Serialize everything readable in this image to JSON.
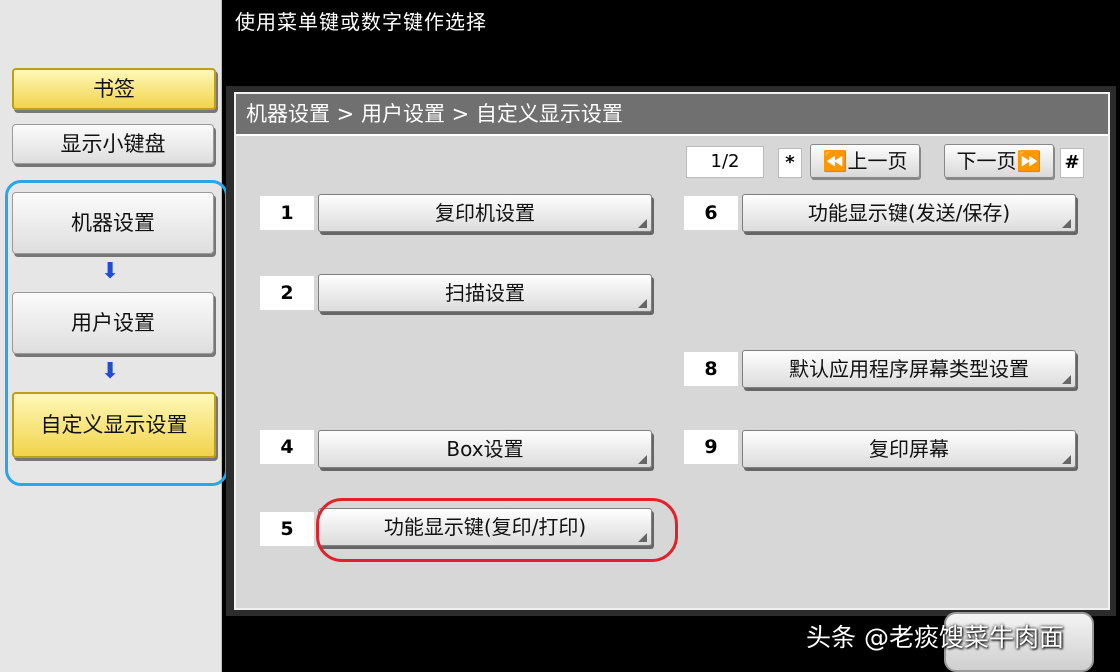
{
  "instruction": "使用菜单键或数字键作选择",
  "sidebar": {
    "bookmark_label": "书签",
    "keypad_label": "显示小键盘",
    "flow": [
      "机器设置",
      "用户设置",
      "自定义显示设置"
    ],
    "arrow_glyph": "⬇"
  },
  "breadcrumb": "机器设置 > 用户设置 > 自定义显示设置",
  "pager": {
    "page": "1/2",
    "prev_key": "*",
    "prev_label": "⏪上一页",
    "next_label": "下一页⏩",
    "next_key": "#"
  },
  "menu": [
    {
      "num": "1",
      "label": "复印机设置"
    },
    {
      "num": "2",
      "label": "扫描设置"
    },
    {
      "num": "4",
      "label": "Box设置"
    },
    {
      "num": "5",
      "label": "功能显示键(复印/打印)"
    },
    {
      "num": "6",
      "label": "功能显示键(发送/保存)"
    },
    {
      "num": "8",
      "label": "默认应用程序屏幕类型设置"
    },
    {
      "num": "9",
      "label": "复印屏幕"
    }
  ],
  "watermark": "头条 @老痰馊菜牛肉面",
  "colors": {
    "highlight": "#e0222a",
    "flow_border": "#28a6e6",
    "selected": "#f1d44b"
  }
}
